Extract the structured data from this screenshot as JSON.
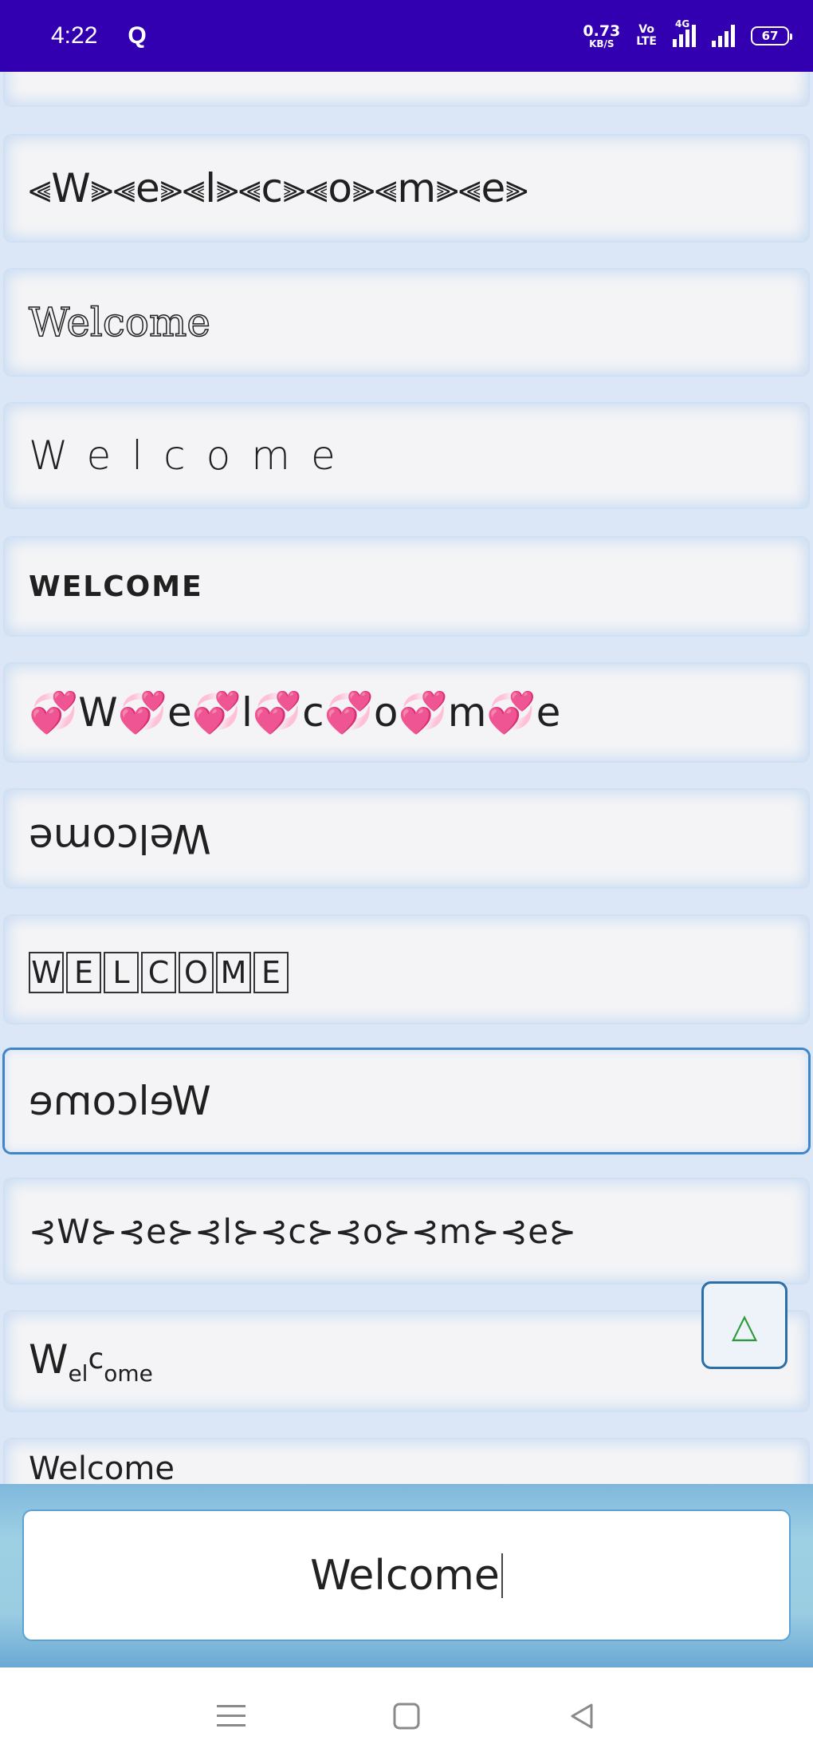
{
  "status_bar": {
    "time": "4:22",
    "app_indicator": "Q",
    "net_speed_value": "0.73",
    "net_speed_unit": "KB/S",
    "volte_line1": "Vo",
    "volte_line2": "LTE",
    "signal_label": "4G",
    "battery": "67"
  },
  "styles": [
    {
      "text": ""
    },
    {
      "text": "⫷W⫸⫷e⫸⫷l⫸⫷c⫸⫷o⫸⫷m⫸⫷e⫸"
    },
    {
      "text": "Welcome"
    },
    {
      "text": "Welcome"
    },
    {
      "text": "WELCOME"
    },
    {
      "text": "💞W💞e💞l💞c💞o💞m💞e"
    },
    {
      "text": "Welcome"
    },
    {
      "text": "WELCOME"
    },
    {
      "text": "Welcome"
    },
    {
      "text": "⊰W⊱⊰e⊱⊰l⊱⊰c⊱⊰o⊱⊰m⊱⊰e⊱"
    },
    {
      "w": "W",
      "el": "el",
      "c": "c",
      "ome": "ome"
    },
    {
      "text": "Welcome"
    }
  ],
  "scroll_top_icon": "△",
  "input": {
    "value": "Welcome"
  },
  "nav": {
    "menu_icon": "menu-icon",
    "home_icon": "home-icon",
    "back_icon": "back-icon"
  }
}
